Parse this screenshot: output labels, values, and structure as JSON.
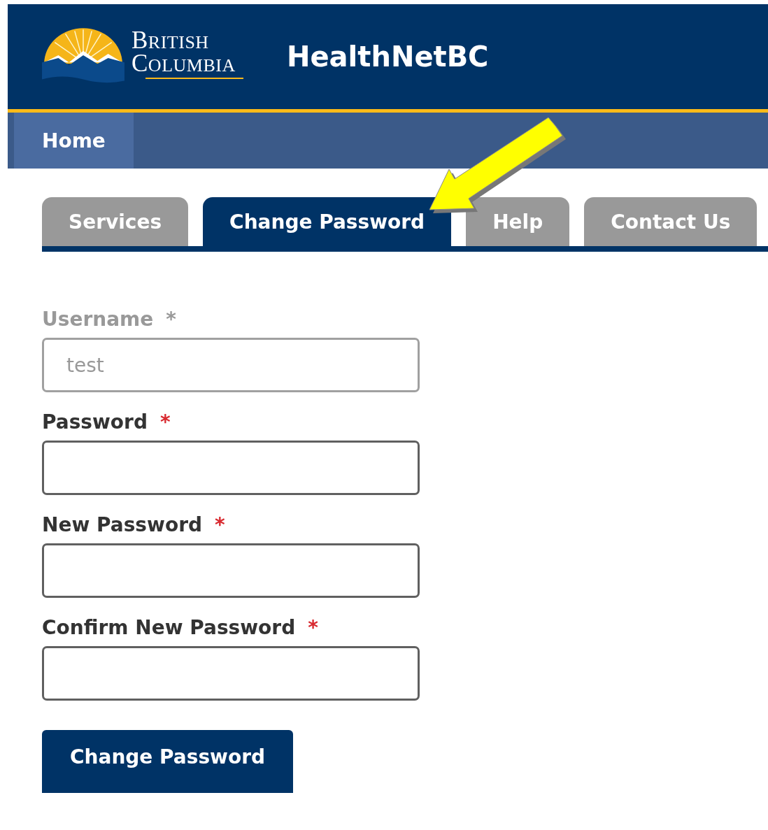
{
  "header": {
    "logo_lines": [
      "BRITISH",
      "COLUMBIA"
    ],
    "title": "HealthNetBC"
  },
  "nav": {
    "items": [
      {
        "label": "Home",
        "selected": true
      }
    ]
  },
  "tabs": [
    {
      "label": "Services",
      "selected": false
    },
    {
      "label": "Change Password",
      "selected": true
    },
    {
      "label": "Help",
      "selected": false
    },
    {
      "label": "Contact Us",
      "selected": false
    }
  ],
  "form": {
    "fields": [
      {
        "label": "Username",
        "marker": "*",
        "value": "test",
        "disabled": true
      },
      {
        "label": "Password",
        "marker": "*",
        "disabled": false
      },
      {
        "label": "New Password",
        "marker": "*",
        "disabled": false
      },
      {
        "label": "Confirm New Password",
        "marker": "*",
        "disabled": false
      }
    ],
    "submit": "Change Password"
  }
}
